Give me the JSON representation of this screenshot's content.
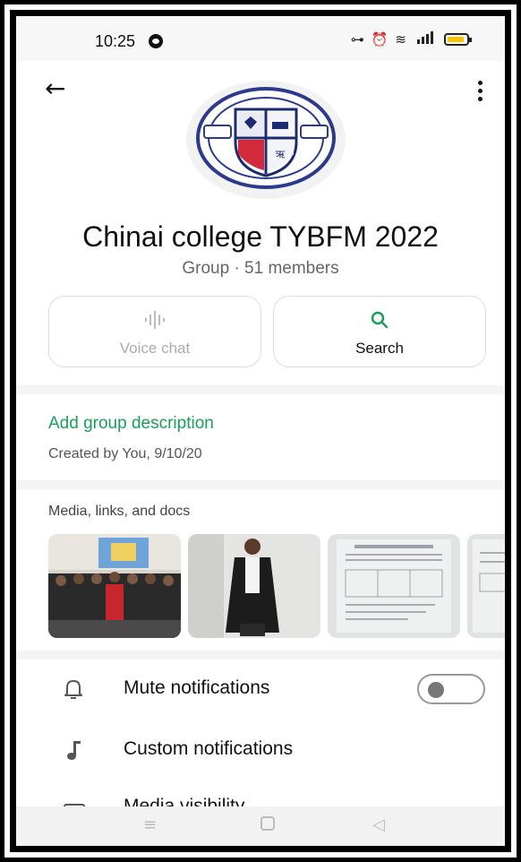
{
  "status_bar": {
    "time": "10:25",
    "icons": [
      "whatsapp-icon",
      "hotspot-icon",
      "alarm-icon",
      "vibrate-icon",
      "signal-icon",
      "battery-icon"
    ]
  },
  "header": {
    "back_icon": "arrow-left-icon",
    "menu_icon": "more-vert-icon"
  },
  "group": {
    "name": "Chinai college TYBFM 2022",
    "subtitle": "Group · 51 members",
    "avatar": "college-seal-logo",
    "seal_text": "SHRI CHINAI COLLEGE OF COMMERCE & ECONOMICS · ANDHERI BOMBAY · ESTD 1963"
  },
  "actions": [
    {
      "label": "Voice chat",
      "icon": "voice-wave-icon",
      "enabled": false
    },
    {
      "label": "Search",
      "icon": "search-icon",
      "enabled": true
    }
  ],
  "description": {
    "add_label": "Add group description",
    "created": "Created by You, 9/10/20"
  },
  "media": {
    "title": "Media, links, and docs",
    "items": [
      "group-photo-thumbnail",
      "graduate-photo-thumbnail",
      "document-photo-thumbnail",
      "document-photo-thumbnail"
    ]
  },
  "menu": [
    {
      "label": "Mute notifications",
      "icon": "bell-icon",
      "toggle": false
    },
    {
      "label": "Custom notifications",
      "icon": "music-note-icon"
    },
    {
      "label": "Media visibility",
      "icon": "media-visibility-icon"
    }
  ],
  "nav_bar": [
    "menu-nav-icon",
    "home-nav-icon",
    "back-nav-icon"
  ],
  "colors": {
    "accent_green": "#1b9e5a",
    "muted_text": "#666666",
    "divider": "#f4f4f4"
  }
}
